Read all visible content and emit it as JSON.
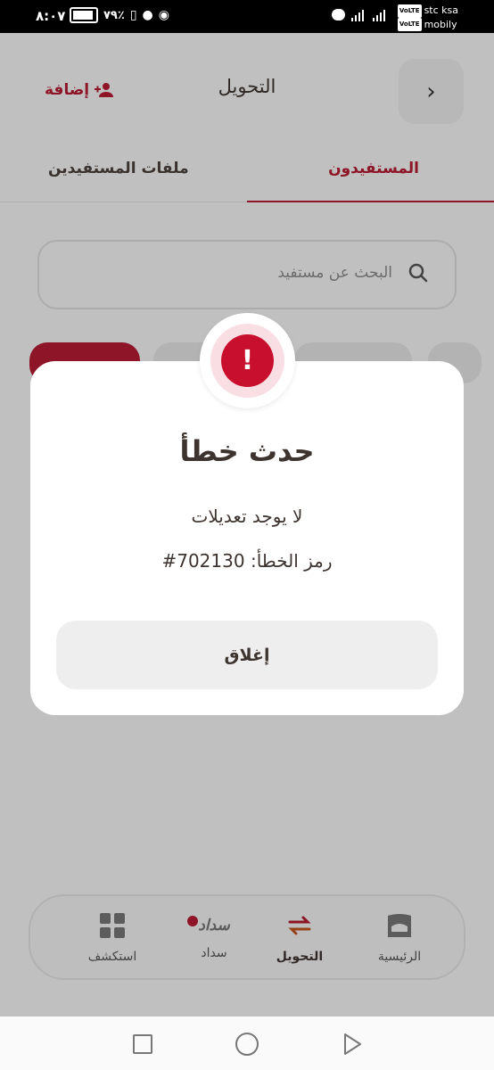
{
  "status_bar": {
    "time": "٨:٠٧",
    "battery": "٧٩٪",
    "carrier_1": "stc ksa",
    "carrier_2": "mobily",
    "network_badge": "VoLTE",
    "network_type": "4G"
  },
  "header": {
    "title": "التحويل",
    "add_label": "إضافة",
    "back_icon": "chevron-right-icon"
  },
  "tabs": [
    {
      "label": "المستفيدون",
      "active": true
    },
    {
      "label": "ملفات المستفيدين",
      "active": false
    }
  ],
  "search": {
    "placeholder": "البحث عن مستفيد"
  },
  "modal": {
    "icon": "exclamation-icon",
    "title": "حدث خطأ",
    "message": "لا يوجد تعديلات",
    "error_code": "رمز الخطأ: 702130#",
    "close_label": "إغلاق"
  },
  "bottom_nav": [
    {
      "label": "الرئيسية",
      "icon": "home-icon",
      "active": false
    },
    {
      "label": "التحويل",
      "icon": "transfer-arrows-icon",
      "active": true
    },
    {
      "label": "سداد",
      "icon": "sadad-logo-icon",
      "active": false,
      "has_badge": true
    },
    {
      "label": "استكشف",
      "icon": "grid-icon",
      "active": false
    }
  ],
  "colors": {
    "accent": "#b71c32",
    "error_red": "#c8102e",
    "text": "#3d3430"
  }
}
